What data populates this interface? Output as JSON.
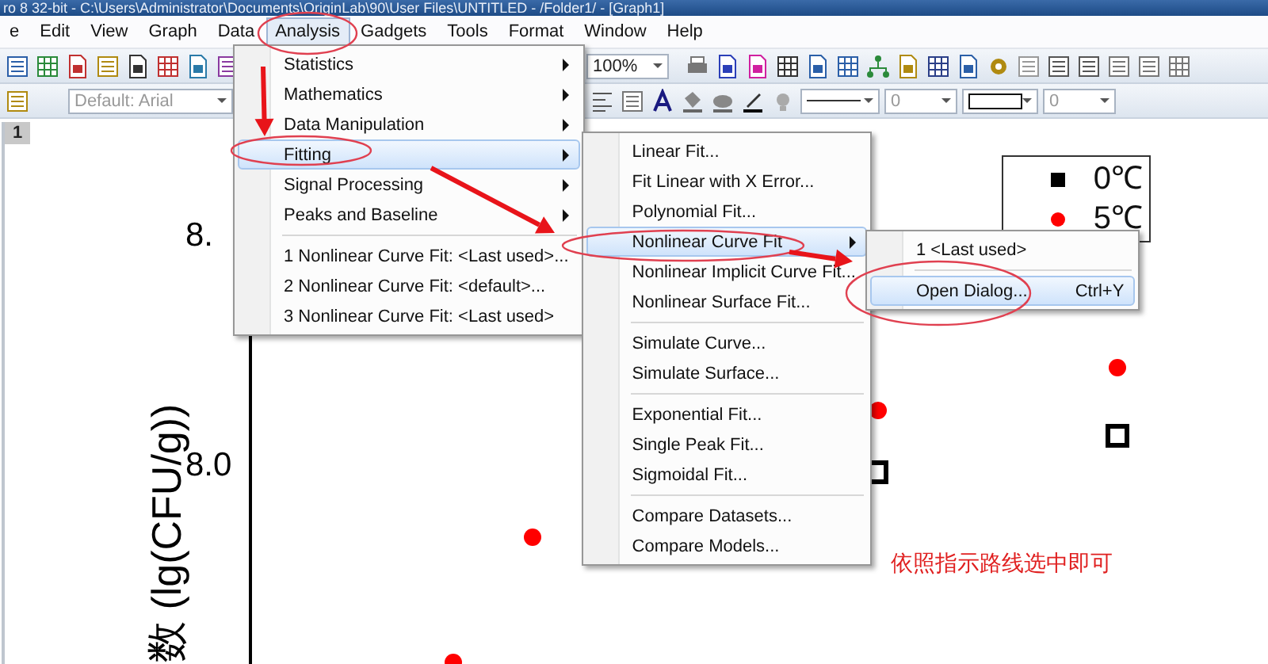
{
  "window": {
    "title": "ro 8 32-bit - C:\\Users\\Administrator\\Documents\\OriginLab\\90\\User Files\\UNTITLED - /Folder1/ - [Graph1]"
  },
  "menu_bar": [
    {
      "label": "e",
      "selected": false
    },
    {
      "label": "Edit",
      "selected": false
    },
    {
      "label": "View",
      "selected": false
    },
    {
      "label": "Graph",
      "selected": false
    },
    {
      "label": "Data",
      "selected": false
    },
    {
      "label": "Analysis",
      "selected": true
    },
    {
      "label": "Gadgets",
      "selected": false
    },
    {
      "label": "Tools",
      "selected": false
    },
    {
      "label": "Format",
      "selected": false
    },
    {
      "label": "Window",
      "selected": false
    },
    {
      "label": "Help",
      "selected": false
    }
  ],
  "toolbar": {
    "zoom": "100%",
    "font": "Default: Arial",
    "fields": [
      "0",
      "0"
    ]
  },
  "graph": {
    "page_tab": "1",
    "y_ticks": [
      "8.",
      "8.0"
    ],
    "y_label": "数 (lg(CFU/g))",
    "legend": [
      {
        "label": "0℃",
        "kind": "square",
        "color": "#000000"
      },
      {
        "label": "5℃",
        "kind": "circle",
        "color": "#ff0000"
      }
    ],
    "note": "依照指示路线选中即可"
  },
  "analysis_menu": {
    "items": [
      {
        "kind": "item",
        "label": "Statistics",
        "submenu": true,
        "selected": false
      },
      {
        "kind": "item",
        "label": "Mathematics",
        "submenu": true,
        "selected": false
      },
      {
        "kind": "item",
        "label": "Data Manipulation",
        "submenu": true,
        "selected": false
      },
      {
        "kind": "item",
        "label": "Fitting",
        "submenu": true,
        "selected": true
      },
      {
        "kind": "item",
        "label": "Signal Processing",
        "submenu": true,
        "selected": false
      },
      {
        "kind": "item",
        "label": "Peaks and Baseline",
        "submenu": true,
        "selected": false
      },
      {
        "kind": "separator"
      },
      {
        "kind": "item",
        "label": "1 Nonlinear Curve Fit: <Last used>...",
        "submenu": false,
        "selected": false
      },
      {
        "kind": "item",
        "label": "2 Nonlinear Curve Fit: <default>...",
        "submenu": false,
        "selected": false
      },
      {
        "kind": "item",
        "label": "3 Nonlinear Curve Fit: <Last used>",
        "submenu": false,
        "selected": false
      }
    ]
  },
  "fitting_menu": {
    "items": [
      {
        "kind": "item",
        "label": "Linear Fit...",
        "submenu": false,
        "selected": false
      },
      {
        "kind": "item",
        "label": "Fit Linear with X Error...",
        "submenu": false,
        "selected": false
      },
      {
        "kind": "item",
        "label": "Polynomial Fit...",
        "submenu": false,
        "selected": false
      },
      {
        "kind": "item",
        "label": "Nonlinear Curve Fit",
        "submenu": true,
        "selected": true
      },
      {
        "kind": "item",
        "label": "Nonlinear Implicit Curve Fit...",
        "submenu": false,
        "selected": false
      },
      {
        "kind": "item",
        "label": "Nonlinear Surface Fit...",
        "submenu": false,
        "selected": false
      },
      {
        "kind": "separator"
      },
      {
        "kind": "item",
        "label": "Simulate Curve...",
        "submenu": false,
        "selected": false
      },
      {
        "kind": "item",
        "label": "Simulate Surface...",
        "submenu": false,
        "selected": false
      },
      {
        "kind": "separator"
      },
      {
        "kind": "item",
        "label": "Exponential Fit...",
        "submenu": false,
        "selected": false
      },
      {
        "kind": "item",
        "label": "Single Peak Fit...",
        "submenu": false,
        "selected": false
      },
      {
        "kind": "item",
        "label": "Sigmoidal Fit...",
        "submenu": false,
        "selected": false
      },
      {
        "kind": "separator"
      },
      {
        "kind": "item",
        "label": "Compare Datasets...",
        "submenu": false,
        "selected": false
      },
      {
        "kind": "item",
        "label": "Compare Models...",
        "submenu": false,
        "selected": false
      }
    ]
  },
  "nonlinear_menu": {
    "items": [
      {
        "kind": "item",
        "label": "1 <Last used>",
        "submenu": false,
        "selected": false
      },
      {
        "kind": "separator"
      },
      {
        "kind": "item",
        "label": "Open Dialog...",
        "shortcut": "Ctrl+Y",
        "submenu": false,
        "selected": true
      }
    ]
  }
}
